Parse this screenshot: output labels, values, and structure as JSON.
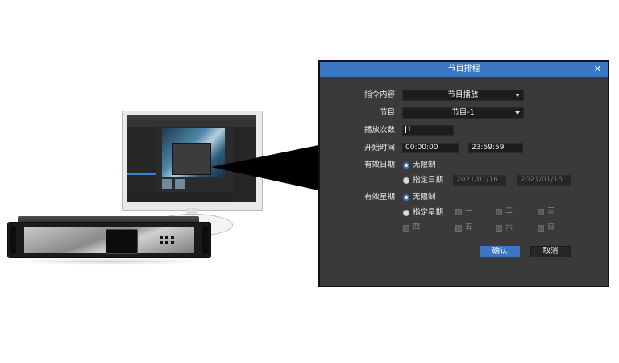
{
  "dialog": {
    "title": "节目排程",
    "close_icon": "close-icon",
    "fields": {
      "command_label": "指令内容",
      "command_value": "节目播放",
      "program_label": "节目",
      "program_value": "节目-1",
      "play_count_label": "播放次数",
      "play_count_value": "1",
      "start_time_label": "开始时间",
      "start_time_from": "00:00:00",
      "start_time_to": "23:59:59",
      "valid_date_label": "有效日期",
      "date_unlimited": "无限制",
      "date_specified": "指定日期",
      "date_from": "2021/01/16",
      "date_to": "2021/01/16",
      "valid_week_label": "有效星期",
      "week_unlimited": "无限制",
      "week_specified": "指定星期",
      "weekdays": [
        "一",
        "二",
        "三",
        "四",
        "五",
        "六",
        "日"
      ]
    },
    "buttons": {
      "confirm": "确认",
      "cancel": "取消"
    }
  },
  "colors": {
    "title_bar": "#3c77c4",
    "dialog_bg": "#3a3a3a",
    "field_bg": "#1d1d1d",
    "primary_button": "#3c77c4"
  },
  "illustration": {
    "monitor": "monitor-with-software",
    "device": "media-server-rack-unit"
  }
}
